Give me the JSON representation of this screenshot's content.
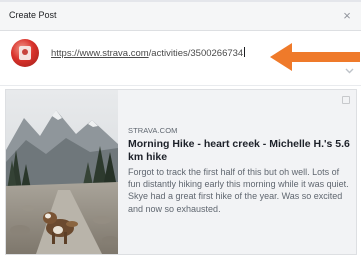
{
  "dialog": {
    "title": "Create Post",
    "close_icon": "close-icon",
    "close_glyph": "×"
  },
  "composer": {
    "avatar_icon": "strava-profile-avatar",
    "url_prefix": "https://",
    "url_link": "www.strava.com",
    "url_suffix": "/activities/3500266734"
  },
  "annotation": {
    "arrow_icon": "arrow-left-icon",
    "arrow_color": "#ef7a2a"
  },
  "link_preview": {
    "image": "hiking-trail-photo-with-dog",
    "domain": "STRAVA.COM",
    "title": "Morning Hike - heart creek - Michelle H.'s 5.6 km hike",
    "description": "Forgot to track the first half of this but oh well. Lots of fun distantly hiking early this morning while it was quiet. Skye had a great first hike of the year. Was so excited and now so exhausted."
  }
}
